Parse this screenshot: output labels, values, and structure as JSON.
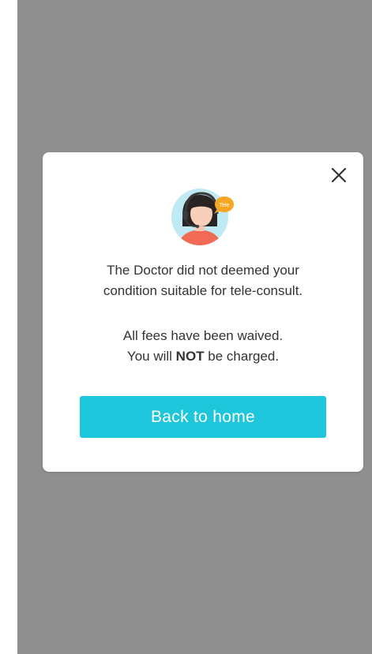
{
  "modal": {
    "close_icon": "close-icon",
    "avatar_icon": "support-agent-avatar-icon",
    "badge_text": "Tele",
    "message_line1": "The Doctor did not deemed your",
    "message_line2": "condition suitable for tele-consult.",
    "fees_line": "All fees have been waived.",
    "charge_prefix": "You will ",
    "charge_bold": "NOT",
    "charge_suffix": " be charged.",
    "button_label": "Back to home"
  },
  "colors": {
    "overlay": "#8f8f8f",
    "accent": "#1ec6dc",
    "badge": "#f5a623"
  }
}
